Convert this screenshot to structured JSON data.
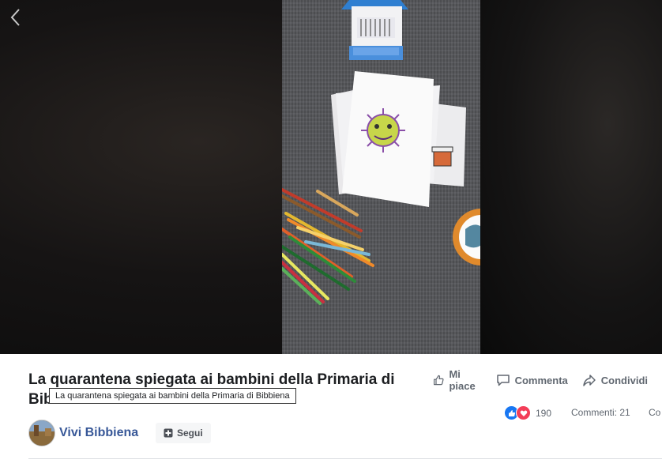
{
  "video": {
    "back_icon": "chevron-left-icon"
  },
  "post": {
    "title": "La quarantena spiegata ai bambini della Primaria di Bibbiena",
    "tooltip": "La quarantena spiegata ai bambini della Primaria di Bibbiena"
  },
  "actions": {
    "like_label": "Mi piace",
    "comment_label": "Commenta",
    "share_label": "Condividi"
  },
  "stats": {
    "reactions_count": "190",
    "comments_label": "Commenti: 21",
    "more_label": "Co"
  },
  "page": {
    "name": "Vivi Bibbiena",
    "follow_label": "Segui"
  },
  "colors": {
    "link": "#385898",
    "like": "#1877f2",
    "love": "#f33e58"
  }
}
